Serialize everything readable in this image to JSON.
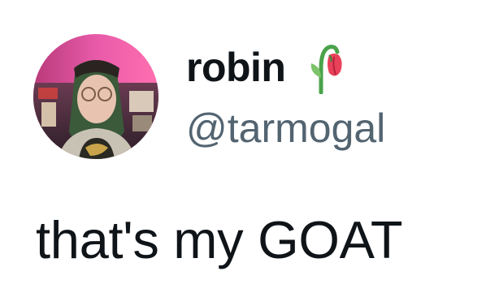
{
  "author": {
    "display_name": "robin",
    "handle": "@tarmogal",
    "avatar": "user-avatar-photo",
    "name_emoji": "wilted-rose-emoji"
  },
  "tweet": {
    "text": "that's my GOAT"
  },
  "colors": {
    "text_primary": "#0f1419",
    "text_secondary": "#536471",
    "background": "#ffffff"
  }
}
